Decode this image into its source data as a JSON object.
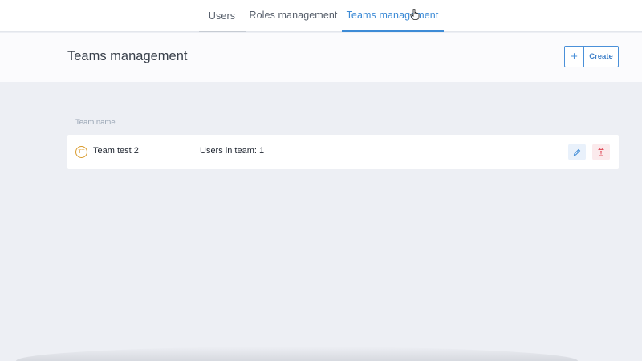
{
  "nav": {
    "tabs": [
      {
        "label": "Users"
      },
      {
        "label": "Roles management"
      },
      {
        "label": "Teams management"
      }
    ]
  },
  "header": {
    "title": "Teams management",
    "create_label": "Create",
    "create_icon": "+"
  },
  "table": {
    "column_header": "Team name",
    "rows": [
      {
        "initials": "TT",
        "name": "Team test 2",
        "users": "Users in team: 1"
      }
    ]
  },
  "colors": {
    "accent": "#3d8bd6",
    "avatar": "#d99a2b",
    "delete": "#e0505e"
  }
}
